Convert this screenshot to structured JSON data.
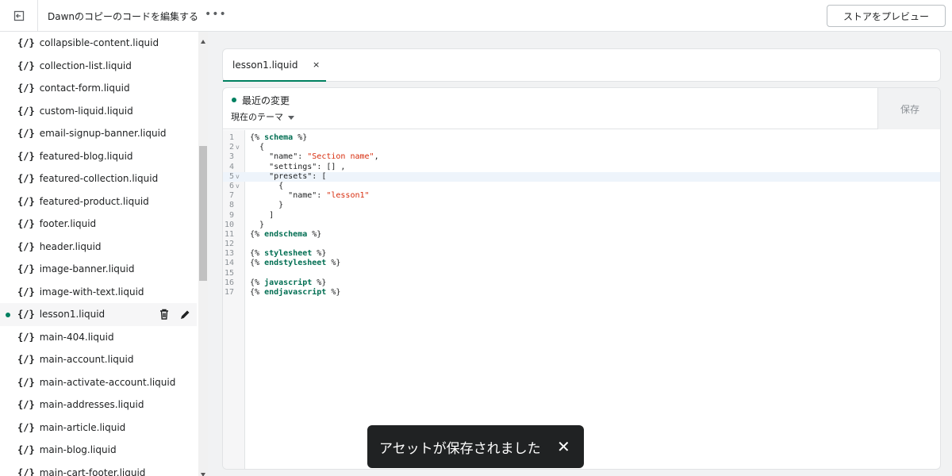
{
  "topbar": {
    "title": "Dawnのコピーのコードを編集する",
    "more_label": "•••",
    "preview_label": "ストアをプレビュー"
  },
  "sidebar": {
    "file_icon": "{/}",
    "files": [
      "collapsible-content.liquid",
      "collection-list.liquid",
      "contact-form.liquid",
      "custom-liquid.liquid",
      "email-signup-banner.liquid",
      "featured-blog.liquid",
      "featured-collection.liquid",
      "featured-product.liquid",
      "footer.liquid",
      "header.liquid",
      "image-banner.liquid",
      "image-with-text.liquid",
      "lesson1.liquid",
      "main-404.liquid",
      "main-account.liquid",
      "main-activate-account.liquid",
      "main-addresses.liquid",
      "main-article.liquid",
      "main-blog.liquid",
      "main-cart-footer.liquid"
    ],
    "active_file": "lesson1.liquid"
  },
  "editor": {
    "tab_label": "lesson1.liquid",
    "tab_close": "×",
    "changes_title": "最近の変更",
    "theme_label": "現在のテーマ",
    "save_label": "保存",
    "lines": [
      {
        "n": "1",
        "fold": "",
        "text": "{% schema %}"
      },
      {
        "n": "2",
        "fold": "v",
        "text": "  {"
      },
      {
        "n": "3",
        "fold": "",
        "text": "    \"name\": \"Section name\","
      },
      {
        "n": "4",
        "fold": "",
        "text": "    \"settings\": [] ,"
      },
      {
        "n": "5",
        "fold": "v",
        "text": "    \"presets\": ["
      },
      {
        "n": "6",
        "fold": "v",
        "text": "      {"
      },
      {
        "n": "7",
        "fold": "",
        "text": "        \"name\": \"lesson1\""
      },
      {
        "n": "8",
        "fold": "",
        "text": "      }"
      },
      {
        "n": "9",
        "fold": "",
        "text": "    ]"
      },
      {
        "n": "10",
        "fold": "",
        "text": "  }"
      },
      {
        "n": "11",
        "fold": "",
        "text": "{% endschema %}"
      },
      {
        "n": "12",
        "fold": "",
        "text": ""
      },
      {
        "n": "13",
        "fold": "",
        "text": "{% stylesheet %}"
      },
      {
        "n": "14",
        "fold": "",
        "text": "{% endstylesheet %}"
      },
      {
        "n": "15",
        "fold": "",
        "text": ""
      },
      {
        "n": "16",
        "fold": "",
        "text": "{% javascript %}"
      },
      {
        "n": "17",
        "fold": "",
        "text": "{% endjavascript %}"
      }
    ],
    "current_line": "5"
  },
  "toast": {
    "message": "アセットが保存されました",
    "close": "✕"
  },
  "colors": {
    "accent": "#008060",
    "toast_bg": "#202223",
    "tag": "#006e52",
    "string": "#d72c0d"
  }
}
